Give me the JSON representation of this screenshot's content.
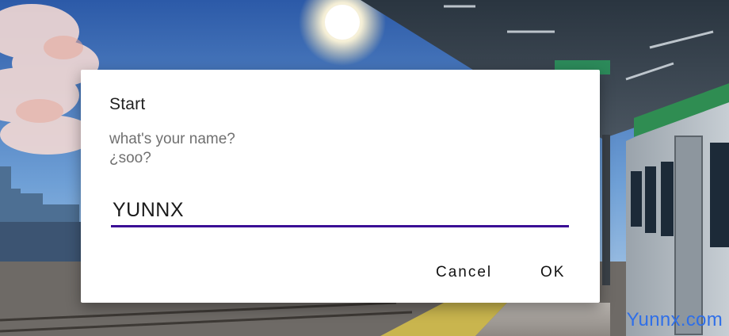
{
  "dialog": {
    "title": "Start",
    "message_lines": [
      "what's your name?",
      "¿soo?"
    ],
    "input_value": "YUNNX",
    "buttons": {
      "cancel_label": "Cancel",
      "ok_label": "OK"
    }
  },
  "watermark": {
    "text": "Yunnx.com"
  },
  "colors": {
    "accent": "#3a0c95",
    "dialog_background": "#ffffff",
    "watermark": "#2f6fe8"
  }
}
